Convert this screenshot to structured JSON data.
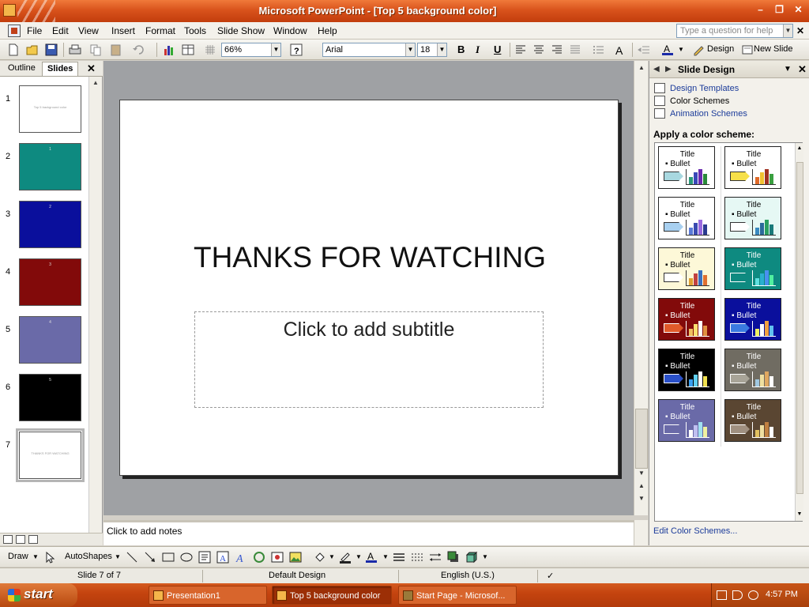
{
  "window": {
    "title": "Microsoft PowerPoint - [Top 5 background color]"
  },
  "menu": {
    "items": [
      "File",
      "Edit",
      "View",
      "Insert",
      "Format",
      "Tools",
      "Slide Show",
      "Window",
      "Help"
    ],
    "ask_placeholder": "Type a question for help"
  },
  "toolbar": {
    "zoom": "66%",
    "font": "Arial",
    "font_size": "18",
    "bold": "B",
    "italic": "I",
    "underline": "U",
    "design_label": "Design",
    "new_slide_label": "New Slide"
  },
  "slides_pane": {
    "tab_outline": "Outline",
    "tab_slides": "Slides",
    "slides": [
      {
        "number": "1",
        "background": "#ffffff",
        "label": "Top 5 background color",
        "mark": ""
      },
      {
        "number": "2",
        "background": "#0e8a80",
        "label": "",
        "mark": "1"
      },
      {
        "number": "3",
        "background": "#0a0f9c",
        "label": "",
        "mark": "2"
      },
      {
        "number": "4",
        "background": "#820a0a",
        "label": "",
        "mark": "3"
      },
      {
        "number": "5",
        "background": "#6a6aa8",
        "label": "",
        "mark": "4"
      },
      {
        "number": "6",
        "background": "#000000",
        "label": "",
        "mark": "5"
      },
      {
        "number": "7",
        "background": "#ffffff",
        "label": "THANKS FOR WATCHING",
        "mark": ""
      }
    ],
    "selected_index": 6
  },
  "slide": {
    "title": "THANKS FOR WATCHING",
    "subtitle_placeholder": "Click to add subtitle"
  },
  "notes": {
    "placeholder": "Click to add notes"
  },
  "task_pane": {
    "title": "Slide Design",
    "links": [
      "Design Templates",
      "Color Schemes",
      "Animation Schemes"
    ],
    "section_label": "Apply a color scheme:",
    "edit_link": "Edit Color Schemes...",
    "scheme_title": "Title",
    "scheme_bullet": "Bullet",
    "schemes": [
      {
        "bg": "#ffffff",
        "text": "#000000",
        "shape": "#a8d8e0",
        "bars": [
          "#2a9a7a",
          "#3a48b8",
          "#6a2ab0",
          "#2a8a3a"
        ]
      },
      {
        "bg": "#ffffff",
        "text": "#000000",
        "shape": "#f6e04a",
        "bars": [
          "#e06a2a",
          "#f0c030",
          "#a03020",
          "#3aa040"
        ]
      },
      {
        "bg": "#ffffff",
        "text": "#000000",
        "shape": "#a8d0f0",
        "bars": [
          "#5a7ad8",
          "#3a4ab0",
          "#9a6ae0",
          "#2a3a90"
        ]
      },
      {
        "bg": "#e6f8f4",
        "text": "#000000",
        "shape": "#ffffff",
        "bars": [
          "#3a8ac0",
          "#2a6a9a",
          "#2aa060",
          "#1a7a7a"
        ]
      },
      {
        "bg": "#fdf8d8",
        "text": "#000000",
        "shape": "#ffffff",
        "bars": [
          "#e0a030",
          "#c04040",
          "#3a70c0",
          "#e07030"
        ]
      },
      {
        "bg": "#0e8a80",
        "text": "#ffffff",
        "shape": "#0e8a80",
        "bars": [
          "#60e0e0",
          "#2ab0d0",
          "#4a90f0",
          "#50f0a0"
        ]
      },
      {
        "bg": "#820a0a",
        "text": "#ffffff",
        "shape": "#e05a2a",
        "bars": [
          "#f0c060",
          "#f8e070",
          "#ffffff",
          "#e09040"
        ]
      },
      {
        "bg": "#0a0f9c",
        "text": "#ffffff",
        "shape": "#3a7ae0",
        "bars": [
          "#f0f060",
          "#ffffff",
          "#f0a040",
          "#60c0f0"
        ]
      },
      {
        "bg": "#000000",
        "text": "#ffffff",
        "shape": "#2a50c8",
        "bars": [
          "#3aa0f0",
          "#60d0f0",
          "#ffffff",
          "#f0e050"
        ]
      },
      {
        "bg": "#706c62",
        "text": "#ffffff",
        "shape": "#a8a498",
        "bars": [
          "#a0c8e0",
          "#f0e0a0",
          "#e0a860",
          "#ffffff"
        ]
      },
      {
        "bg": "#6a6aa8",
        "text": "#ffffff",
        "shape": "#6a6aa8",
        "bars": [
          "#ffffff",
          "#c0c0f0",
          "#a0e0f0",
          "#f0f0a0"
        ]
      },
      {
        "bg": "#5a4632",
        "text": "#ffffff",
        "shape": "#a09080",
        "bars": [
          "#e0c060",
          "#f0e0a0",
          "#c08040",
          "#ffffff"
        ]
      }
    ]
  },
  "drawbar": {
    "draw_label": "Draw",
    "autoshapes_label": "AutoShapes"
  },
  "status": {
    "slide": "Slide 7 of 7",
    "design": "Default Design",
    "language": "English (U.S.)"
  },
  "taskbar": {
    "start_label": "start",
    "items": [
      "Presentation1",
      "Top 5 background color",
      "Start Page - Microsof..."
    ],
    "active_index": 1,
    "clock": "4:57 PM"
  }
}
